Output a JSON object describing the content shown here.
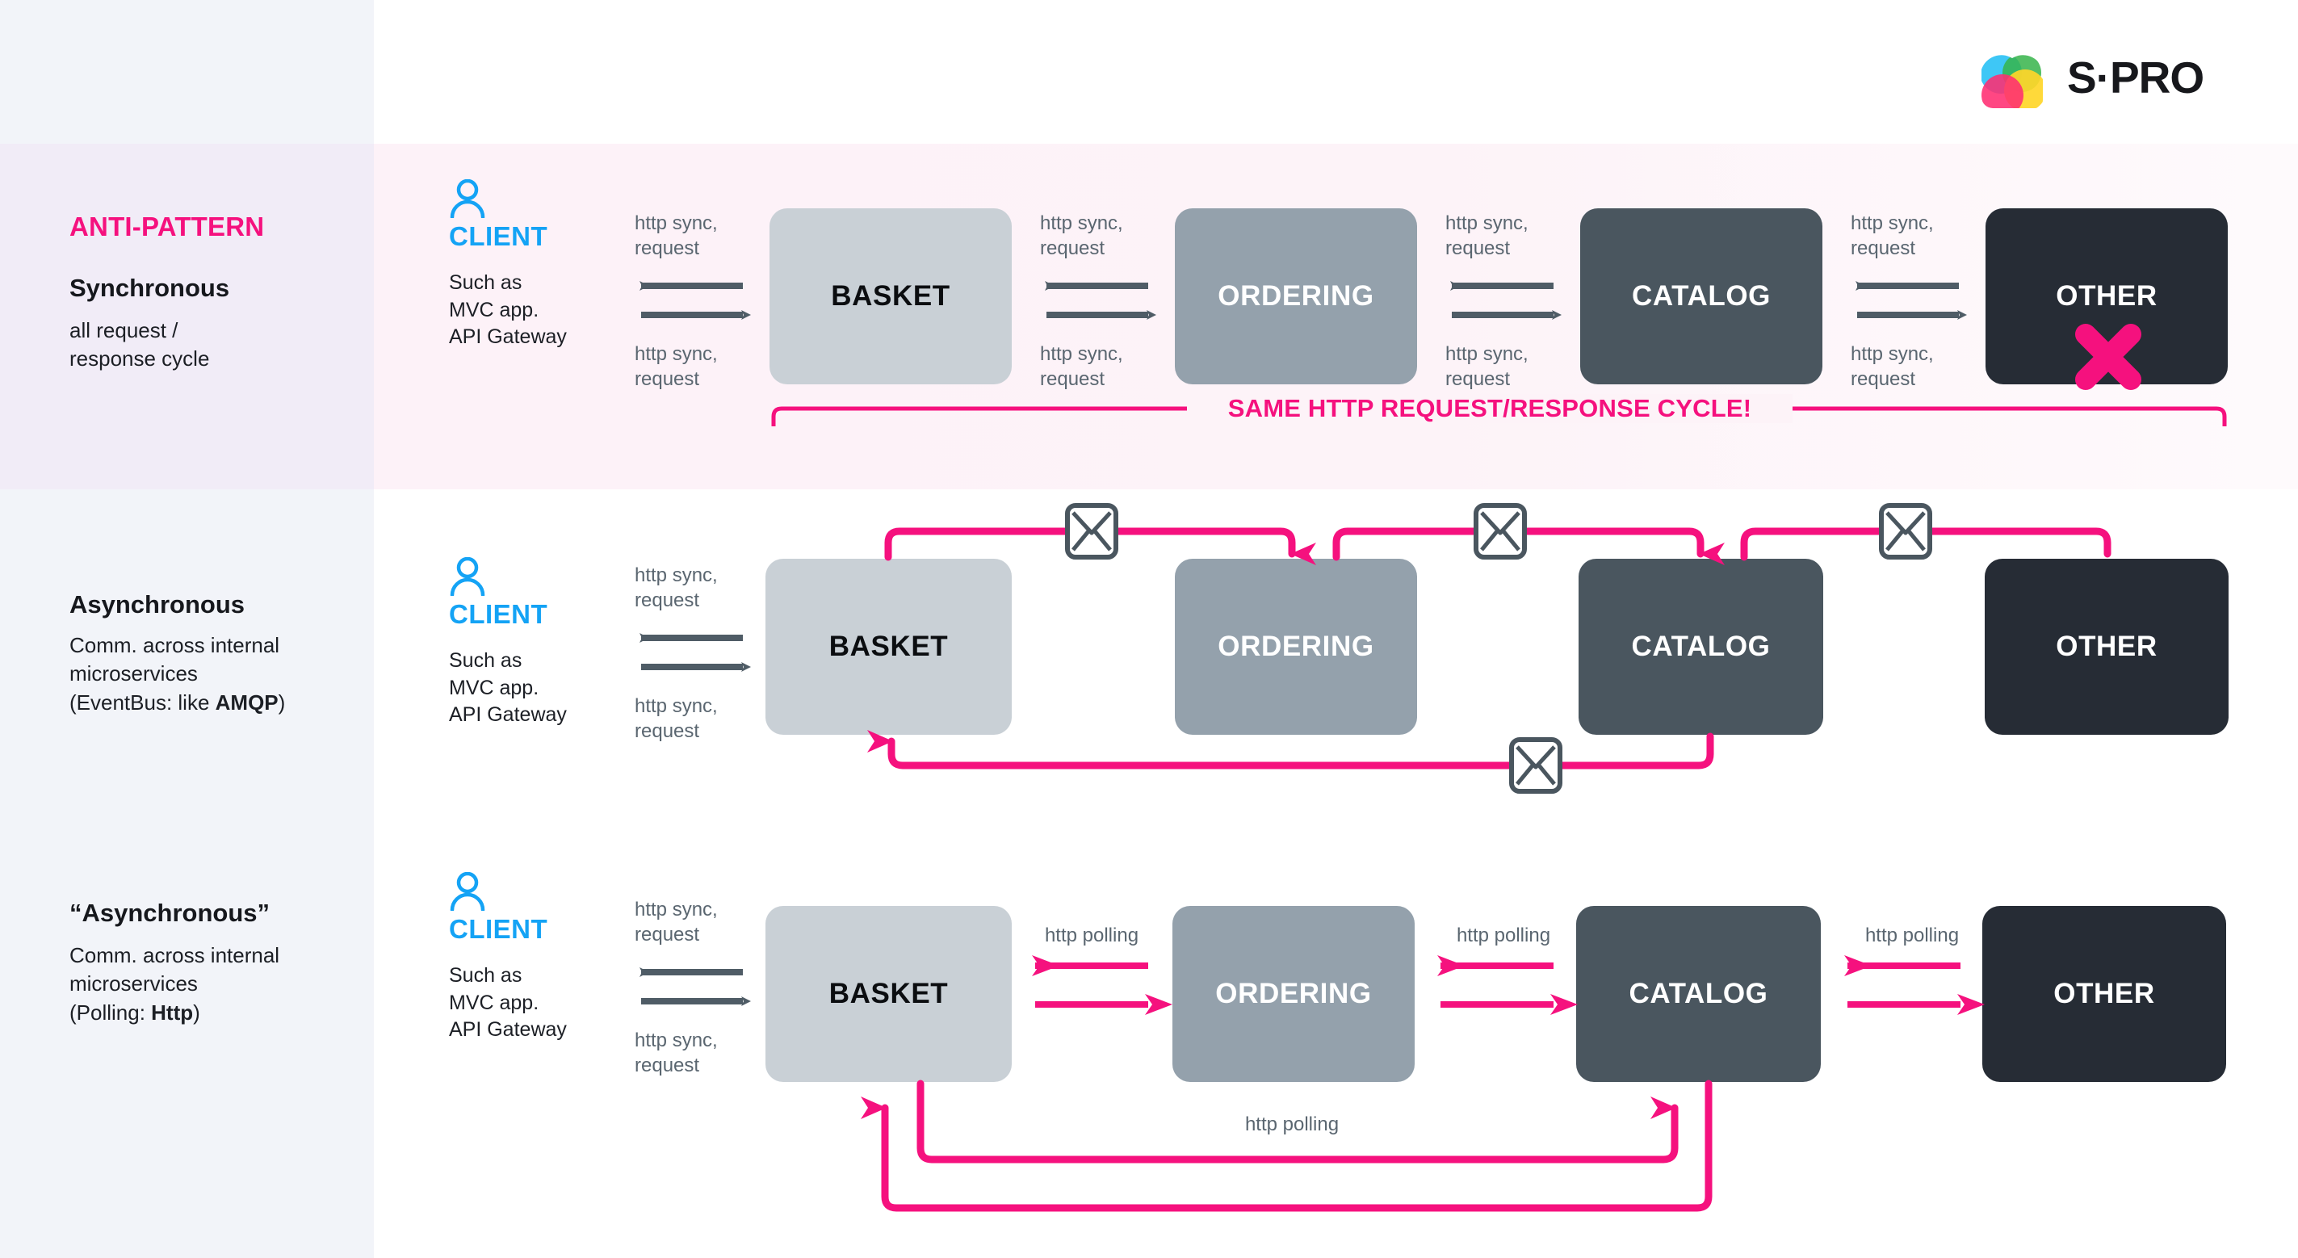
{
  "brand": {
    "name": "S·PRO",
    "logo_icon": "spro-heart-logo",
    "colors": {
      "accent_pink": "#f5117e",
      "client_blue": "#14a3f5",
      "basket": "#c9d0d6",
      "ordering": "#94a1ac",
      "catalog": "#4a565f",
      "other": "#262c35",
      "arrow_gray": "#4f5c66",
      "label_gray": "#5a6670"
    }
  },
  "rows": [
    {
      "id": "anti-pattern",
      "kicker": "ANTI-PATTERN",
      "title": "Synchronous",
      "subtitle": "all request /\nresponse cycle",
      "client": {
        "icon": "user-icon",
        "name": "CLIENT",
        "desc": "Such as\nMVC app.\nAPI Gateway"
      },
      "services": [
        "BASKET",
        "ORDERING",
        "CATALOG",
        "OTHER"
      ],
      "link_label_top": "http sync,\nrequest",
      "link_label_bottom": "http sync,\nrequest",
      "error_marker": "x-mark-icon",
      "bracket_text": "SAME HTTP REQUEST/RESPONSE CYCLE!"
    },
    {
      "id": "asynchronous",
      "kicker": "",
      "title": "Asynchronous",
      "subtitle": "Comm. across internal\nmicroservices\n(EventBus: like AMQP)",
      "subtitle_bold": "AMQP",
      "client": {
        "icon": "user-icon",
        "name": "CLIENT",
        "desc": "Such as\nMVC app.\nAPI Gateway"
      },
      "services": [
        "BASKET",
        "ORDERING",
        "CATALOG",
        "OTHER"
      ],
      "link_label_top": "http sync,\nrequest",
      "link_label_bottom": "http sync,\nrequest",
      "message_icon": "envelope-icon",
      "message_icon_count": 4
    },
    {
      "id": "pseudo-asynchronous",
      "kicker": "",
      "title": "“Asynchronous”",
      "subtitle": "Comm. across internal\nmicroservices\n(Polling: Http)",
      "subtitle_bold": "Http",
      "client": {
        "icon": "user-icon",
        "name": "CLIENT",
        "desc": "Such as\nMVC app.\nAPI Gateway"
      },
      "services": [
        "BASKET",
        "ORDERING",
        "CATALOG",
        "OTHER"
      ],
      "link_label_top": "http sync,\nrequest",
      "link_label_bottom": "http sync,\nrequest",
      "polling_label": "http polling",
      "polling_loop_label": "http polling"
    }
  ]
}
